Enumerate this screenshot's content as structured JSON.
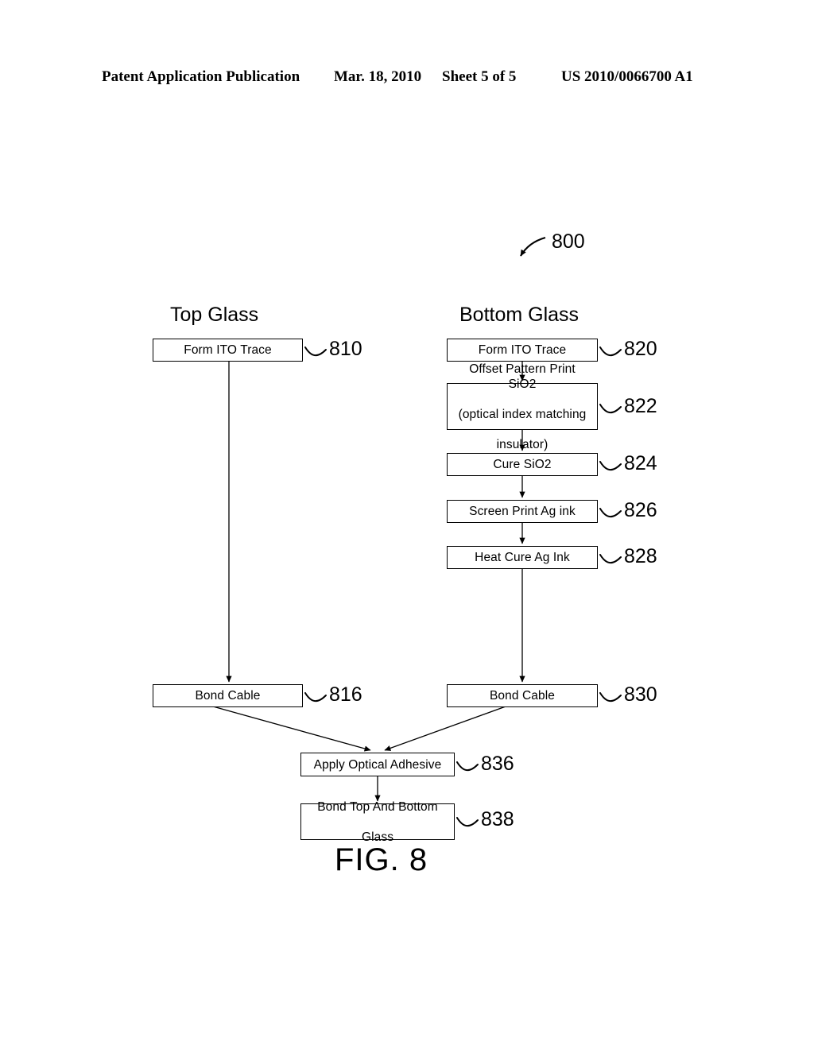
{
  "header": {
    "publication": "Patent Application Publication",
    "date": "Mar. 18, 2010",
    "sheet": "Sheet 5 of 5",
    "patent_number": "US 2010/0066700 A1"
  },
  "figure": {
    "caption": "FIG. 8",
    "figure_ref": "800",
    "columns": [
      {
        "title": "Top Glass"
      },
      {
        "title": "Bottom Glass"
      }
    ],
    "nodes": [
      {
        "id": "810",
        "label": "Form ITO Trace"
      },
      {
        "id": "820",
        "label": "Form ITO Trace"
      },
      {
        "id": "822",
        "label": "Offset Pattern Print SiO2 (optical index matching insulator)",
        "lines": [
          "Offset Pattern Print SiO2",
          "(optical index matching",
          "insulator)"
        ]
      },
      {
        "id": "824",
        "label": "Cure SiO2"
      },
      {
        "id": "826",
        "label": "Screen Print Ag ink"
      },
      {
        "id": "828",
        "label": "Heat Cure Ag Ink"
      },
      {
        "id": "816",
        "label": "Bond Cable"
      },
      {
        "id": "830",
        "label": "Bond Cable"
      },
      {
        "id": "836",
        "label": "Apply Optical Adhesive"
      },
      {
        "id": "838",
        "label": "Bond Top And Bottom Glass",
        "lines": [
          "Bond Top And Bottom",
          "Glass"
        ]
      }
    ],
    "node_labels": {
      "n810": "Form ITO Trace",
      "n820": "Form ITO Trace",
      "n822_l1": "Offset Pattern Print SiO2",
      "n822_l2": "(optical index matching",
      "n822_l3": "insulator)",
      "n824": "Cure SiO2",
      "n826": "Screen Print Ag ink",
      "n828": "Heat Cure Ag Ink",
      "n816": "Bond Cable",
      "n830": "Bond Cable",
      "n836": "Apply Optical Adhesive",
      "n838_l1": "Bond Top And Bottom",
      "n838_l2": "Glass"
    },
    "refs": {
      "r810": "810",
      "r820": "820",
      "r822": "822",
      "r824": "824",
      "r826": "826",
      "r828": "828",
      "r816": "816",
      "r830": "830",
      "r836": "836",
      "r838": "838",
      "r800": "800"
    },
    "colors": {
      "ink": "#000000",
      "paper": "#ffffff"
    }
  }
}
